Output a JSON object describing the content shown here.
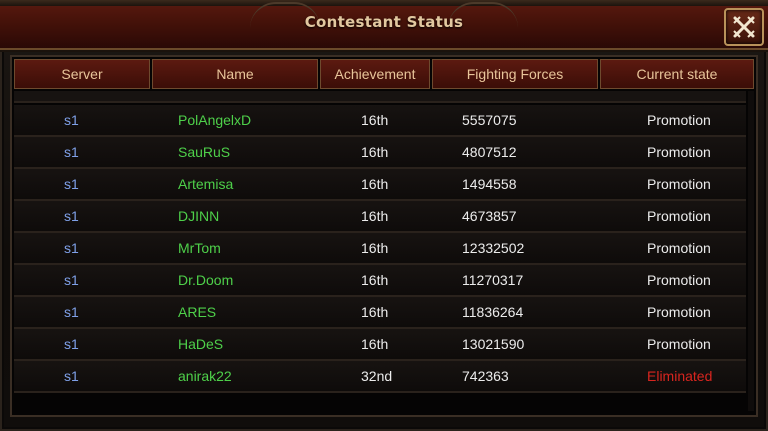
{
  "window": {
    "title": "Contestant Status"
  },
  "columns": [
    "Server",
    "Name",
    "Achievement",
    "Fighting Forces",
    "Current state"
  ],
  "rows": [
    {
      "server": "s1",
      "name": "PolAngelxD",
      "achievement": "16th",
      "forces": "5557075",
      "state": "Promotion"
    },
    {
      "server": "s1",
      "name": "SauRuS",
      "achievement": "16th",
      "forces": "4807512",
      "state": "Promotion"
    },
    {
      "server": "s1",
      "name": "Artemisa",
      "achievement": "16th",
      "forces": "1494558",
      "state": "Promotion"
    },
    {
      "server": "s1",
      "name": "DJINN",
      "achievement": "16th",
      "forces": "4673857",
      "state": "Promotion"
    },
    {
      "server": "s1",
      "name": "MrTom",
      "achievement": "16th",
      "forces": "12332502",
      "state": "Promotion"
    },
    {
      "server": "s1",
      "name": "Dr.Doom",
      "achievement": "16th",
      "forces": "11270317",
      "state": "Promotion"
    },
    {
      "server": "s1",
      "name": "ARES",
      "achievement": "16th",
      "forces": "11836264",
      "state": "Promotion"
    },
    {
      "server": "s1",
      "name": "HaDeS",
      "achievement": "16th",
      "forces": "13021590",
      "state": "Promotion"
    },
    {
      "server": "s1",
      "name": "anirak22",
      "achievement": "32nd",
      "forces": "742363",
      "state": "Eliminated"
    }
  ],
  "colors": {
    "server_text": "#7fa0e8",
    "name_text": "#4ed04a",
    "promotion_text": "#ececec",
    "eliminated_text": "#d8251f",
    "header_text": "#e8c59a"
  },
  "icons": {
    "close": "crossed-swords-close-icon"
  }
}
